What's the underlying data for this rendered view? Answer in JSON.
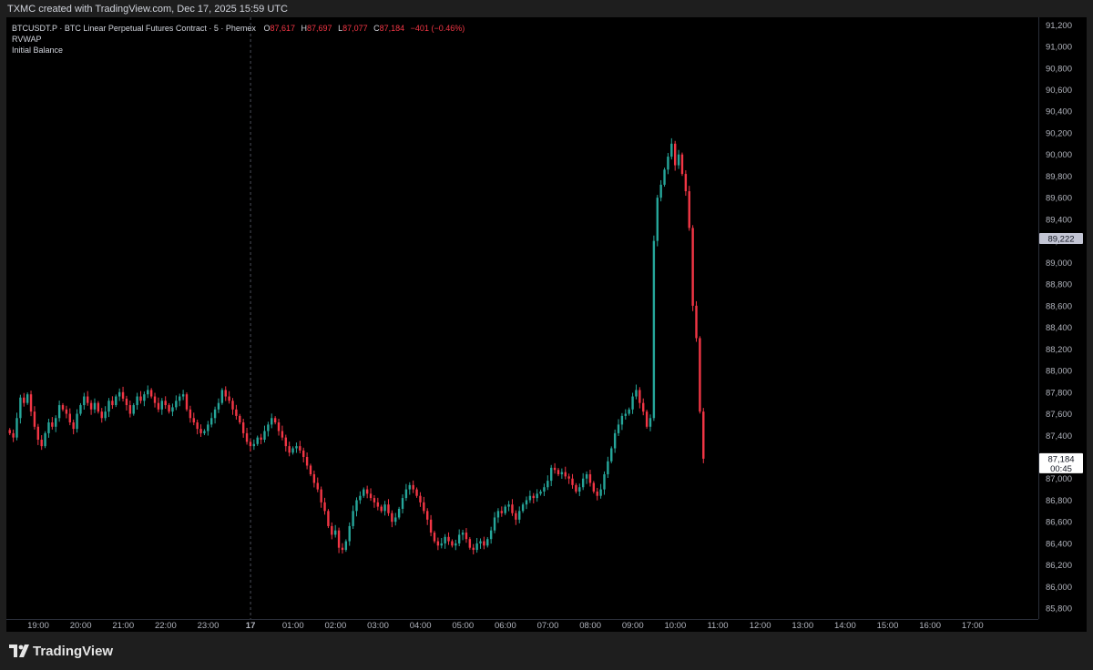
{
  "header": {
    "attribution": "TXMC created with TradingView.com, Dec 17, 2025 15:59 UTC"
  },
  "legend": {
    "symbol": "BTCUSDT.P · BTC Linear Perpetual Futures Contract · 5 · Phemex",
    "o_label": "O",
    "o_value": "87,617",
    "h_label": "H",
    "h_value": "87,697",
    "l_label": "L",
    "l_value": "87,077",
    "c_label": "C",
    "c_value": "87,184",
    "change": "−401 (−0.46%)",
    "indicators": [
      "RVWAP",
      "Initial Balance"
    ]
  },
  "footer": {
    "brand": "TradingView"
  },
  "colors": {
    "up": "#26a69a",
    "down": "#f23645",
    "background": "#000000",
    "axis_text": "#b2b5be",
    "price_tag": "#ffffff",
    "marker_tag": "#c3c5d4"
  },
  "chart_data": {
    "type": "candlestick",
    "y_ticks": [
      85800,
      86000,
      86200,
      86400,
      86600,
      86800,
      87000,
      87200,
      87400,
      87600,
      87800,
      88000,
      88200,
      88400,
      88600,
      88800,
      89000,
      89200,
      89400,
      89600,
      89800,
      90000,
      90200,
      90400,
      90600,
      90800,
      91000,
      91200
    ],
    "y_tick_labels": [
      "85,800",
      "86,000",
      "86,200",
      "86,400",
      "86,600",
      "86,800",
      "87,000",
      "87,200",
      "87,400",
      "87,600",
      "87,800",
      "88,000",
      "88,200",
      "88,400",
      "88,600",
      "88,800",
      "89,000",
      "89,200",
      "89,400",
      "89,600",
      "89,800",
      "90,000",
      "90,200",
      "90,400",
      "90,600",
      "90,800",
      "91,000",
      "91,200"
    ],
    "ylim": [
      85700,
      91270
    ],
    "x_tick_labels": [
      "19:00",
      "20:00",
      "21:00",
      "22:00",
      "23:00",
      "17",
      "01:00",
      "02:00",
      "03:00",
      "04:00",
      "05:00",
      "06:00",
      "07:00",
      "08:00",
      "09:00",
      "10:00",
      "11:00",
      "12:00",
      "13:00",
      "14:00",
      "15:00",
      "16:00",
      "17:00"
    ],
    "x_tick_hours": [
      19,
      20,
      21,
      22,
      23,
      24,
      25,
      26,
      27,
      28,
      29,
      30,
      31,
      32,
      33,
      34,
      35,
      36,
      37,
      38,
      39,
      40,
      41
    ],
    "xlim_hours": [
      18.25,
      42.55
    ],
    "day_separator_hour": 24,
    "candle_minutes": 5,
    "start_hour": 18.33,
    "closes": [
      87420,
      87380,
      87560,
      87750,
      87700,
      87780,
      87620,
      87480,
      87360,
      87300,
      87420,
      87520,
      87480,
      87560,
      87680,
      87640,
      87600,
      87520,
      87460,
      87600,
      87680,
      87760,
      87700,
      87640,
      87700,
      87620,
      87560,
      87620,
      87720,
      87680,
      87760,
      87800,
      87740,
      87680,
      87600,
      87680,
      87760,
      87720,
      87780,
      87820,
      87760,
      87700,
      87640,
      87720,
      87680,
      87620,
      87660,
      87720,
      87760,
      87780,
      87640,
      87560,
      87520,
      87460,
      87420,
      87440,
      87500,
      87560,
      87640,
      87700,
      87820,
      87760,
      87720,
      87640,
      87580,
      87520,
      87420,
      87340,
      87300,
      87320,
      87380,
      87360,
      87440,
      87500,
      87560,
      87520,
      87440,
      87380,
      87300,
      87240,
      87280,
      87300,
      87260,
      87200,
      87120,
      87040,
      86960,
      86900,
      86780,
      86700,
      86560,
      86480,
      86520,
      86360,
      86340,
      86420,
      86560,
      86700,
      86800,
      86840,
      86900,
      86860,
      86820,
      86780,
      86740,
      86700,
      86760,
      86680,
      86600,
      86640,
      86720,
      86820,
      86900,
      86940,
      86900,
      86840,
      86780,
      86700,
      86620,
      86500,
      86420,
      86380,
      86400,
      86460,
      86420,
      86380,
      86400,
      86480,
      86500,
      86440,
      86360,
      86340,
      86400,
      86420,
      86380,
      86440,
      86520,
      86640,
      86700,
      86680,
      86740,
      86760,
      86680,
      86620,
      86700,
      86760,
      86800,
      86840,
      86820,
      86860,
      86880,
      86920,
      86980,
      87100,
      87080,
      87040,
      87060,
      87020,
      87000,
      86940,
      86880,
      86920,
      87000,
      87040,
      86960,
      86880,
      86840,
      86900,
      87040,
      87160,
      87280,
      87420,
      87500,
      87580,
      87600,
      87640,
      87760,
      87820,
      87700,
      87620,
      87480,
      87560,
      89200,
      89600,
      89720,
      89860,
      89980,
      90100,
      89900,
      90000,
      89820,
      89660,
      89320,
      88600,
      88300,
      87620,
      87184
    ],
    "opens_shift_note": ""
  },
  "price_markers": [
    {
      "name": "crosshair-price",
      "value": 89222,
      "label": "89,222"
    },
    {
      "name": "last-price",
      "value": 87184,
      "label": "87,184",
      "countdown": "00:45"
    }
  ]
}
